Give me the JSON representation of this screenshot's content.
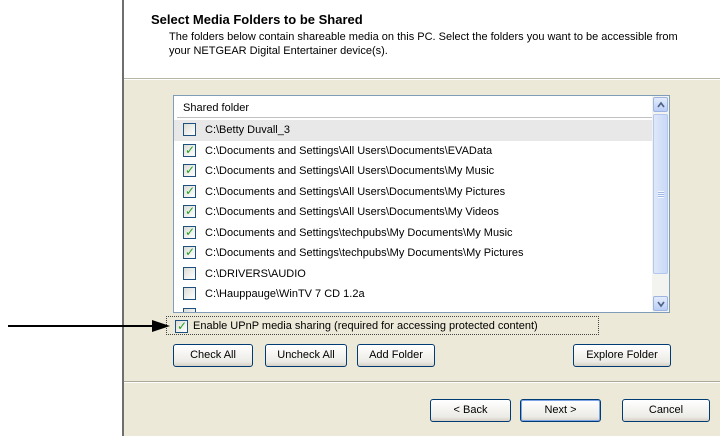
{
  "header": {
    "title": "Select Media Folders to be Shared",
    "description": "The folders below contain shareable media on this PC. Select the folders you want to be accessible from your NETGEAR Digital Entertainer device(s)."
  },
  "folder_list": {
    "column_header": "Shared folder",
    "rows": [
      {
        "path": "C:\\Betty Duvall_3",
        "checked": false
      },
      {
        "path": "C:\\Documents and Settings\\All Users\\Documents\\EVAData",
        "checked": true
      },
      {
        "path": "C:\\Documents and Settings\\All Users\\Documents\\My Music",
        "checked": true
      },
      {
        "path": "C:\\Documents and Settings\\All Users\\Documents\\My Pictures",
        "checked": true
      },
      {
        "path": "C:\\Documents and Settings\\All Users\\Documents\\My Videos",
        "checked": true
      },
      {
        "path": "C:\\Documents and Settings\\techpubs\\My Documents\\My Music",
        "checked": true
      },
      {
        "path": "C:\\Documents and Settings\\techpubs\\My Documents\\My Pictures",
        "checked": true
      },
      {
        "path": "C:\\DRIVERS\\AUDIO",
        "checked": false
      },
      {
        "path": "C:\\Hauppauge\\WinTV 7 CD 1.2a",
        "checked": false
      },
      {
        "path": "",
        "checked": false
      }
    ]
  },
  "upnp": {
    "label": "Enable UPnP media sharing (required for accessing protected content)",
    "checked": true
  },
  "buttons": {
    "check_all": "Check All",
    "uncheck_all": "Uncheck All",
    "add_folder": "Add Folder",
    "explore_folder": "Explore Folder",
    "back": "< Back",
    "next": "Next >",
    "cancel": "Cancel"
  },
  "colors": {
    "dialog_bg": "#ece9d8",
    "list_border": "#7f9db9",
    "checkmark": "#21a121",
    "button_border": "#003c74"
  }
}
